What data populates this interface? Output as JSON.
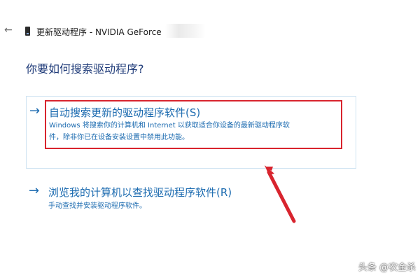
{
  "window": {
    "back_icon": "back-arrow-icon",
    "device_icon": "device-icon",
    "title": "更新驱动程序 - NVIDIA GeForce"
  },
  "question": "你要如何搜索驱动程序?",
  "option_auto": {
    "arrow": "→",
    "title": "自动搜索更新的驱动程序软件(S)",
    "desc_line1": "Windows 将搜索你的计算机和 Internet 以获取适合你设备的最新驱动程序软",
    "desc_line2": "件，除非你已在设备安装设置中禁用此功能。"
  },
  "option_browse": {
    "arrow": "→",
    "title": "浏览我的计算机以查找驱动程序软件(R)",
    "desc": "手动查找并安装驱动程序软件。"
  },
  "watermark": "头条 @农金杀",
  "colors": {
    "link_blue": "#1c6bb0",
    "heading_blue": "#1e3a78",
    "highlight_red": "#d8242e"
  }
}
